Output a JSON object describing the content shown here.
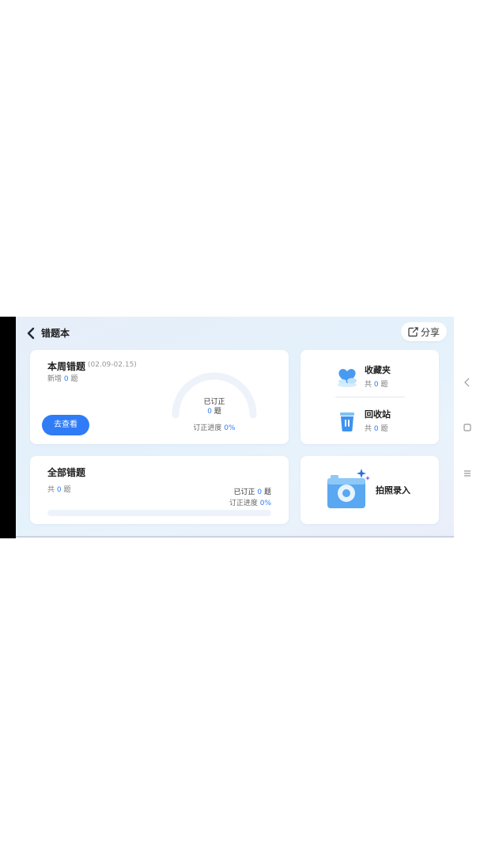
{
  "header": {
    "title": "错题本",
    "share_label": "分享"
  },
  "weekly": {
    "title": "本周错题",
    "date_range": "(02.09-02.15)",
    "new_prefix": "新增",
    "new_count": "0",
    "new_suffix": "题",
    "view_button": "去查看",
    "corrected_label": "已订正",
    "corrected_count": "0",
    "corrected_suffix": "题",
    "progress_label": "订正进度",
    "progress_value": "0%",
    "progress_fraction": 0
  },
  "favorites": {
    "title": "收藏夹",
    "prefix": "共",
    "count": "0",
    "suffix": "题"
  },
  "recycle": {
    "title": "回收站",
    "prefix": "共",
    "count": "0",
    "suffix": "题"
  },
  "all": {
    "title": "全部错题",
    "total_prefix": "共",
    "total_count": "0",
    "total_suffix": "题",
    "corrected_label": "已订正",
    "corrected_count": "0",
    "corrected_suffix": "题",
    "progress_label": "订正进度",
    "progress_value": "0%",
    "progress_fraction": 0
  },
  "photo": {
    "label": "拍照录入"
  },
  "colors": {
    "accent": "#2f7cf6",
    "icon_blue": "#5aa7f2",
    "gauge_track": "#eef2fa"
  },
  "icons": [
    "back-arrow-icon",
    "share-icon",
    "heart-cloud-icon",
    "trash-bin-icon",
    "camera-icon",
    "sparkle-icon"
  ],
  "system_nav": [
    "back-nav-icon",
    "home-nav-icon",
    "menu-nav-icon"
  ]
}
